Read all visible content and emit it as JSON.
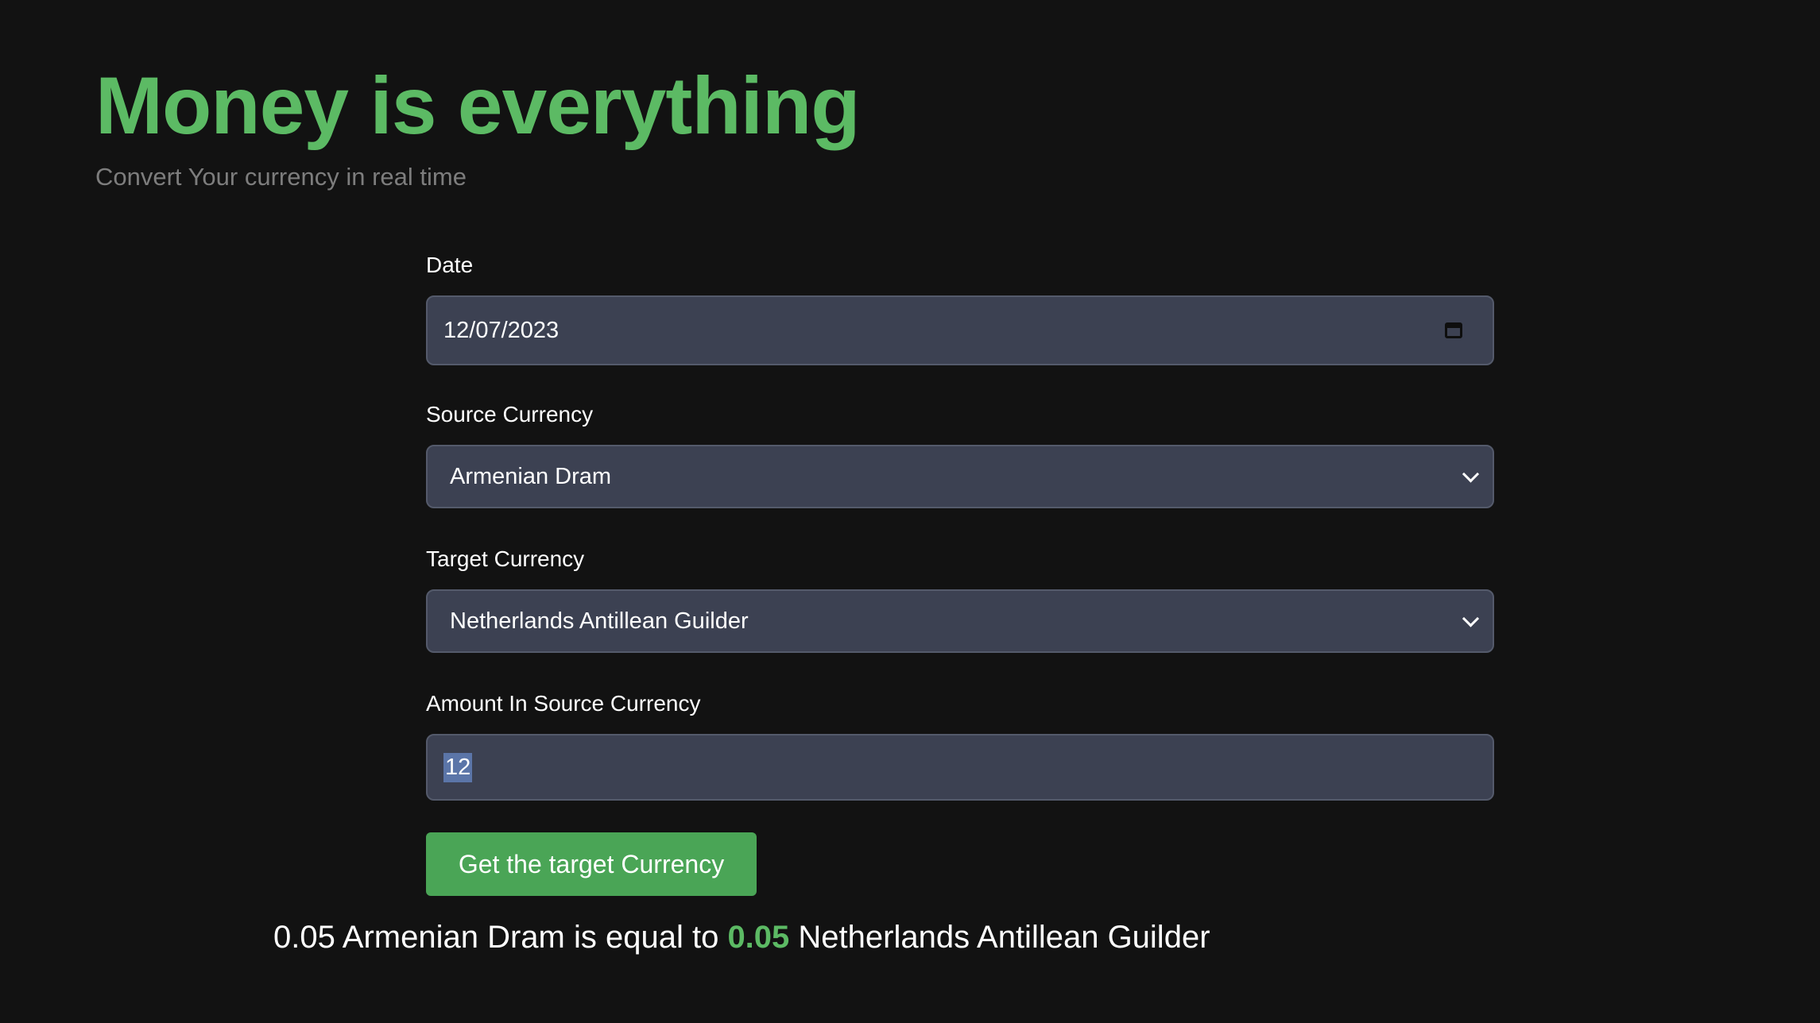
{
  "header": {
    "title": "Money is everything",
    "subtitle": "Convert Your currency in real time"
  },
  "form": {
    "date": {
      "label": "Date",
      "value": "12/07/2023",
      "icon": "calendar-icon"
    },
    "source_currency": {
      "label": "Source Currency",
      "value": "Armenian Dram",
      "icon": "chevron-down-icon"
    },
    "target_currency": {
      "label": "Target Currency",
      "value": "Netherlands Antillean Guilder",
      "icon": "chevron-down-icon"
    },
    "amount": {
      "label": "Amount In Source Currency",
      "value": "12"
    },
    "submit_label": "Get the target Currency"
  },
  "result": {
    "source_amount": "0.05",
    "source_currency": "Armenian Dram",
    "connector": "is equal to",
    "target_amount": "0.05",
    "target_currency": "Netherlands Antillean Guilder"
  },
  "colors": {
    "background": "#121212",
    "accent": "#5cba64",
    "button": "#4aa556",
    "input_bg": "#3c4152",
    "subtitle": "#7d7d7d"
  }
}
